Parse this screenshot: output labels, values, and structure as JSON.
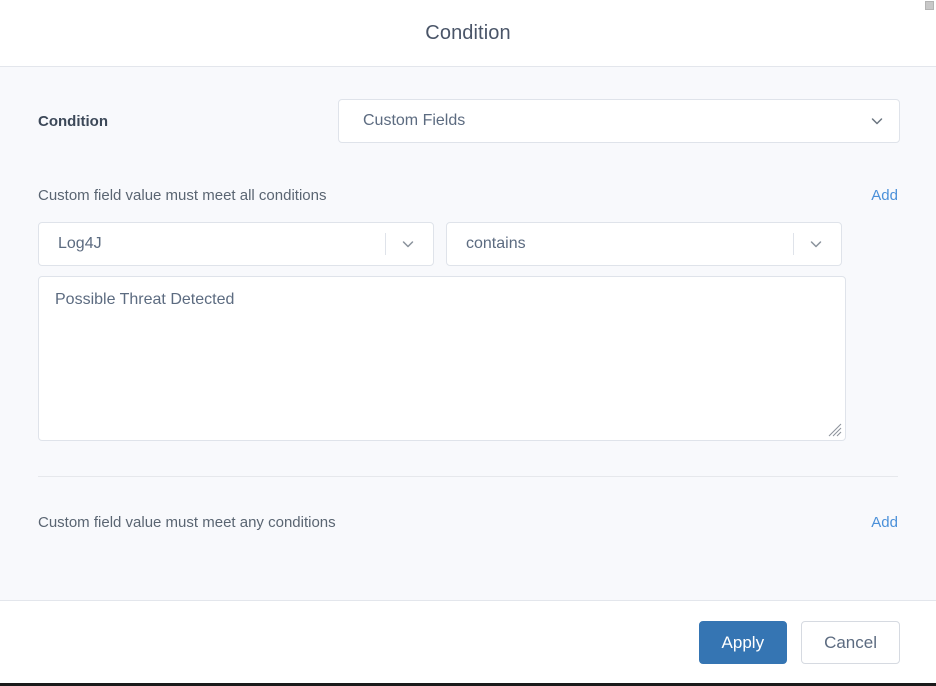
{
  "dialog": {
    "title": "Condition"
  },
  "condition": {
    "label": "Condition",
    "select_value": "Custom Fields",
    "chevron_icon": "chevron-down-icon"
  },
  "all_section": {
    "label": "Custom field value must meet all conditions",
    "add_label": "Add",
    "field": {
      "value": "Log4J",
      "chevron_icon": "chevron-down-icon"
    },
    "operator": {
      "value": "contains",
      "chevron_icon": "chevron-down-icon"
    },
    "value_textarea": {
      "value": "Possible Threat Detected",
      "placeholder": "",
      "resize_handle_icon": "resize-grip-icon"
    }
  },
  "any_section": {
    "label": "Custom field value must meet any conditions",
    "add_label": "Add"
  },
  "footer": {
    "apply_label": "Apply",
    "cancel_label": "Cancel"
  },
  "colors": {
    "accent_blue": "#3575b3",
    "link_blue": "#4a90d9",
    "body_background": "#f8f9fc",
    "border": "#dfe3ea",
    "text": "#5c6b80"
  }
}
